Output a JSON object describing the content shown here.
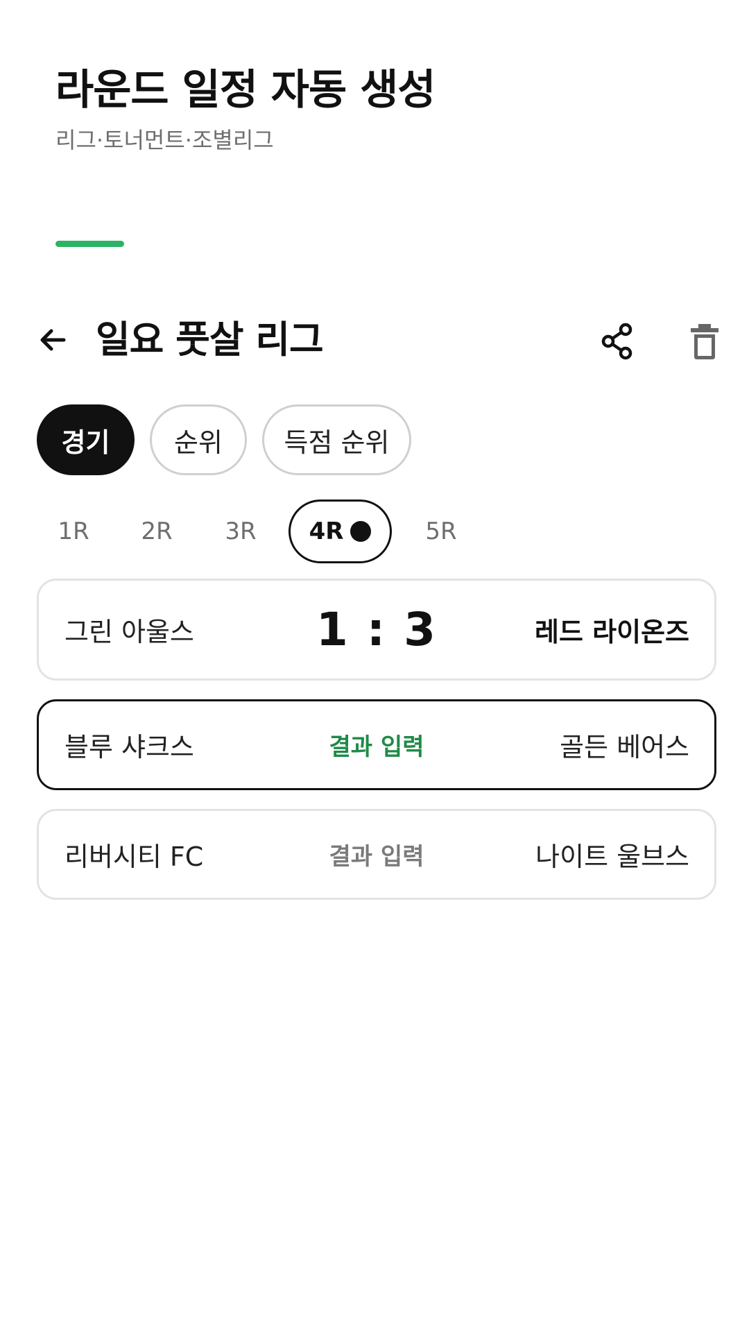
{
  "app": {
    "title": "라운드 일정 자동 생성",
    "subtitle": "리그·토너먼트·조별리그",
    "accent_color": "#2bb463"
  },
  "toolbar": {
    "back_icon": "arrow-left-icon",
    "league_name": "일요 풋살 리그",
    "share_icon": "share-icon",
    "delete_icon": "trash-icon"
  },
  "view_tabs": {
    "selected": "경기",
    "items": [
      {
        "label": "경기"
      },
      {
        "label": "순위"
      },
      {
        "label": "득점 순위"
      }
    ]
  },
  "rounds": {
    "selected": "4R",
    "items": [
      {
        "label": "1R"
      },
      {
        "label": "2R"
      },
      {
        "label": "3R"
      },
      {
        "label": "4R"
      },
      {
        "label": "5R"
      }
    ]
  },
  "matches": [
    {
      "home": "그린 아울스",
      "away": "레드 라이온즈",
      "score": "1 : 3"
    },
    {
      "home": "블루 샤크스",
      "away": "골든 베어스",
      "action": "결과 입력"
    },
    {
      "home": "리버시티 FC",
      "away": "나이트 울브스",
      "action": "결과 입력"
    }
  ],
  "colors": {
    "active_action": "#1e8a47",
    "muted_action": "#7a7a7a",
    "selected_border": "#111111",
    "card_border": "#e3e3e3"
  }
}
